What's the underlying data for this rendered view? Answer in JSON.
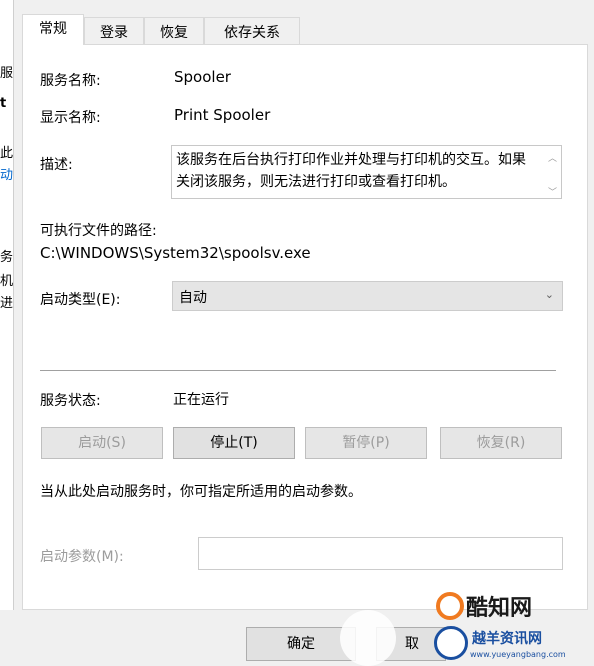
{
  "behind_window": {
    "fragments": [
      "服",
      "t",
      "此",
      "动",
      "务",
      "机",
      "进"
    ]
  },
  "tabs": [
    {
      "label": "常规",
      "active": true
    },
    {
      "label": "登录",
      "active": false
    },
    {
      "label": "恢复",
      "active": false
    },
    {
      "label": "依存关系",
      "active": false
    }
  ],
  "fields": {
    "service_name_label": "服务名称:",
    "service_name_value": "Spooler",
    "display_name_label": "显示名称:",
    "display_name_value": "Print Spooler",
    "description_label": "描述:",
    "description_value": "该服务在后台执行打印作业并处理与打印机的交互。如果关闭该服务，则无法进行打印或查看打印机。",
    "exe_path_label": "可执行文件的路径:",
    "exe_path_value": "C:\\WINDOWS\\System32\\spoolsv.exe",
    "startup_type_label": "启动类型(E):",
    "startup_type_value": "自动"
  },
  "status": {
    "label": "服务状态:",
    "value": "正在运行"
  },
  "control_buttons": {
    "start": "启动(S)",
    "stop": "停止(T)",
    "pause": "暂停(P)",
    "resume": "恢复(R)"
  },
  "hint_text": "当从此处启动服务时，你可指定所适用的启动参数。",
  "start_params_label": "启动参数(M):",
  "dialog_buttons": {
    "ok": "确定",
    "cancel": "取"
  },
  "watermarks": {
    "kuzhi": "酷知网",
    "site_cn": "越羊资讯网",
    "site_url": "www.yueyangbang.com"
  },
  "colors": {
    "panel_bg": "#ffffff",
    "dialog_bg": "#f0f0f0",
    "disabled_text": "#9c9c9c",
    "watermark_blue": "#1a4fa0",
    "watermark_orange": "#f07a20"
  }
}
